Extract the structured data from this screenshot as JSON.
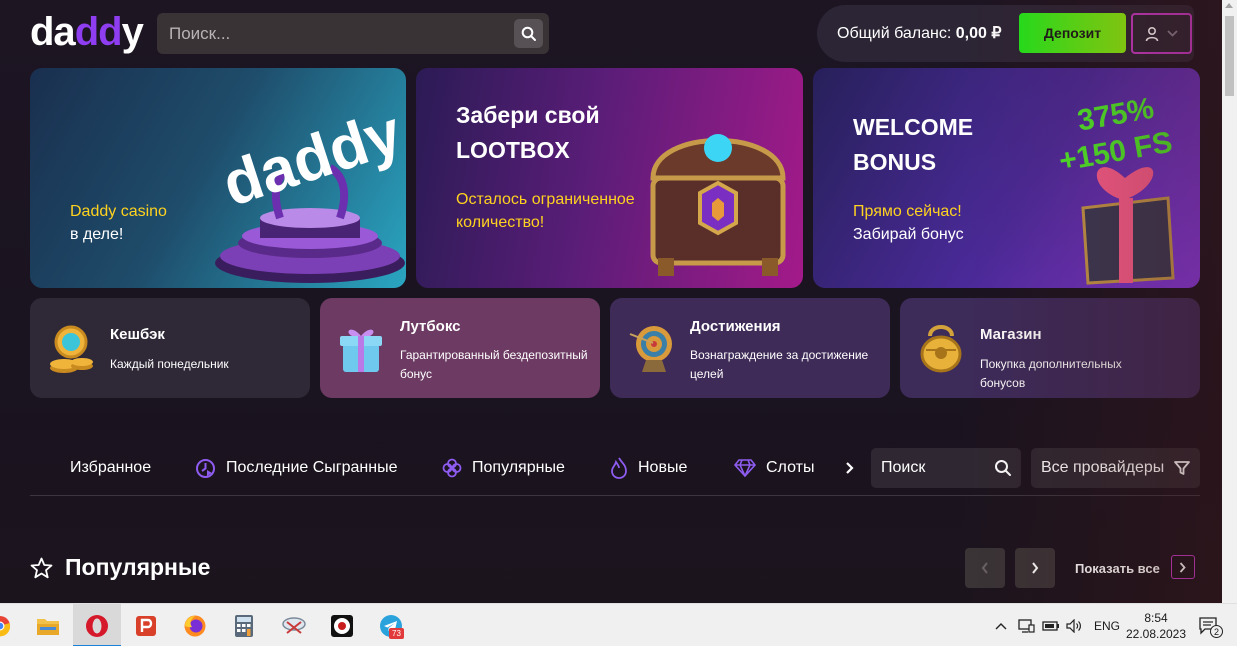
{
  "header": {
    "logo": {
      "part1": "da",
      "part2": "dd",
      "part3": "y"
    },
    "search_placeholder": "Поиск...",
    "balance_label": "Общий баланс:",
    "balance_value": "0,00 ₽",
    "deposit_label": "Депозит"
  },
  "banners": [
    {
      "title": "",
      "yellow": "Daddy casino",
      "white": "в деле!",
      "art_text": "daddy"
    },
    {
      "title_line1": "Забери свой",
      "title_line2": "LOOTBOX",
      "yellow_line1": "Осталось ограниченное",
      "yellow_line2": "количество!"
    },
    {
      "title_line1": "WELCOME",
      "title_line2": "BONUS",
      "yellow": "Прямо сейчас!",
      "white": "Забирай бонус",
      "promo_line1": "375%",
      "promo_line2": "+150 FS"
    }
  ],
  "cards": [
    {
      "title": "Кешбэк",
      "sub": "Каждый понедельник",
      "icon": "coins-icon"
    },
    {
      "title": "Лутбокс",
      "sub": "Гарантированный бездепозитный бонус",
      "icon": "gift-box-icon"
    },
    {
      "title": "Достижения",
      "sub": "Вознаграждение за достижение целей",
      "icon": "target-icon"
    },
    {
      "title": "Магазин",
      "sub": "Покупка дополнительных бонусов",
      "icon": "treasure-bag-icon"
    }
  ],
  "categories": [
    {
      "label": "Избранное",
      "icon": ""
    },
    {
      "label": "Последние Сыгранные",
      "icon": "clock-play-icon"
    },
    {
      "label": "Популярные",
      "icon": "clover-icon"
    },
    {
      "label": "Новые",
      "icon": "flame-icon"
    },
    {
      "label": "Слоты",
      "icon": "diamond-icon"
    }
  ],
  "game_search_placeholder": "Поиск",
  "providers_label": "Все провайдеры",
  "popular": {
    "title": "Популярные",
    "show_all": "Показать все"
  },
  "taskbar": {
    "apps": [
      "chrome-icon",
      "file-explorer-icon",
      "opera-icon",
      "p-app-icon",
      "firefox-icon",
      "calculator-icon",
      "snipping-icon",
      "poker-app-icon",
      "telegram-icon"
    ],
    "telegram_badge": "73",
    "language": "ENG",
    "time": "8:54",
    "date": "22.08.2023",
    "notification_count": "2"
  },
  "colors": {
    "accent_purple": "#8e3df0",
    "deposit_green": "#23e81c",
    "banner_yellow": "#ffd21f",
    "user_border": "#c83ac8"
  }
}
